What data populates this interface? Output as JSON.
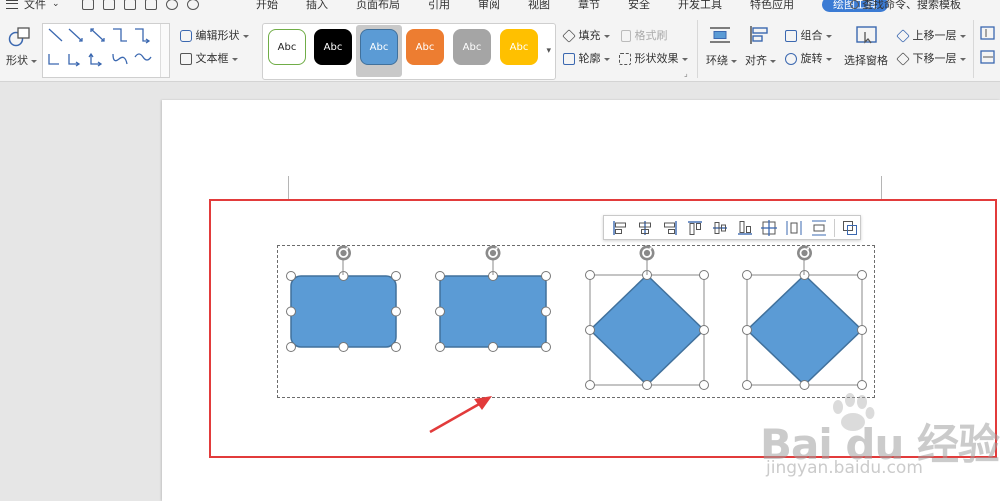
{
  "menu": {
    "file_label": "文件",
    "tabs": [
      "开始",
      "插入",
      "页面布局",
      "引用",
      "审阅",
      "视图",
      "章节",
      "安全",
      "开发工具",
      "特色应用",
      "绘图工具"
    ],
    "active_tab": "绘图工具",
    "search_label": "查找命令、搜索模板"
  },
  "ribbon": {
    "shape_label": "形状",
    "edit_shape_label": "编辑形状",
    "textbox_label": "文本框",
    "style_swatches": [
      {
        "text": "Abc",
        "bg": "#ffffff",
        "fg": "#222222",
        "border": "#70ad47"
      },
      {
        "text": "Abc",
        "bg": "#000000",
        "fg": "#ffffff",
        "border": "#000000"
      },
      {
        "text": "Abc",
        "bg": "#5b9bd5",
        "fg": "#ffffff",
        "border": "#41719c"
      },
      {
        "text": "Abc",
        "bg": "#ed7d31",
        "fg": "#ffffff",
        "border": "#ed7d31"
      },
      {
        "text": "Abc",
        "bg": "#a5a5a5",
        "fg": "#ffffff",
        "border": "#a5a5a5"
      },
      {
        "text": "Abc",
        "bg": "#ffc000",
        "fg": "#ffffff",
        "border": "#ffc000"
      }
    ],
    "fill_label": "填充",
    "format_painter_label": "格式刷",
    "outline_label": "轮廓",
    "shape_effect_label": "形状效果",
    "wrap_label": "环绕",
    "align_label": "对齐",
    "group_label": "组合",
    "rotate_label": "旋转",
    "selection_pane_label": "选择窗格",
    "bring_forward_label": "上移一层",
    "send_backward_label": "下移一层"
  },
  "canvas": {
    "shape_fill": "#5b9bd5",
    "shape_stroke": "#41719c",
    "highlight_color": "#e23b3b",
    "arrow_color": "#e23b3b"
  },
  "watermark": {
    "logo_text": "Bai du 经验",
    "url_text": "jingyan.baidu.com"
  }
}
